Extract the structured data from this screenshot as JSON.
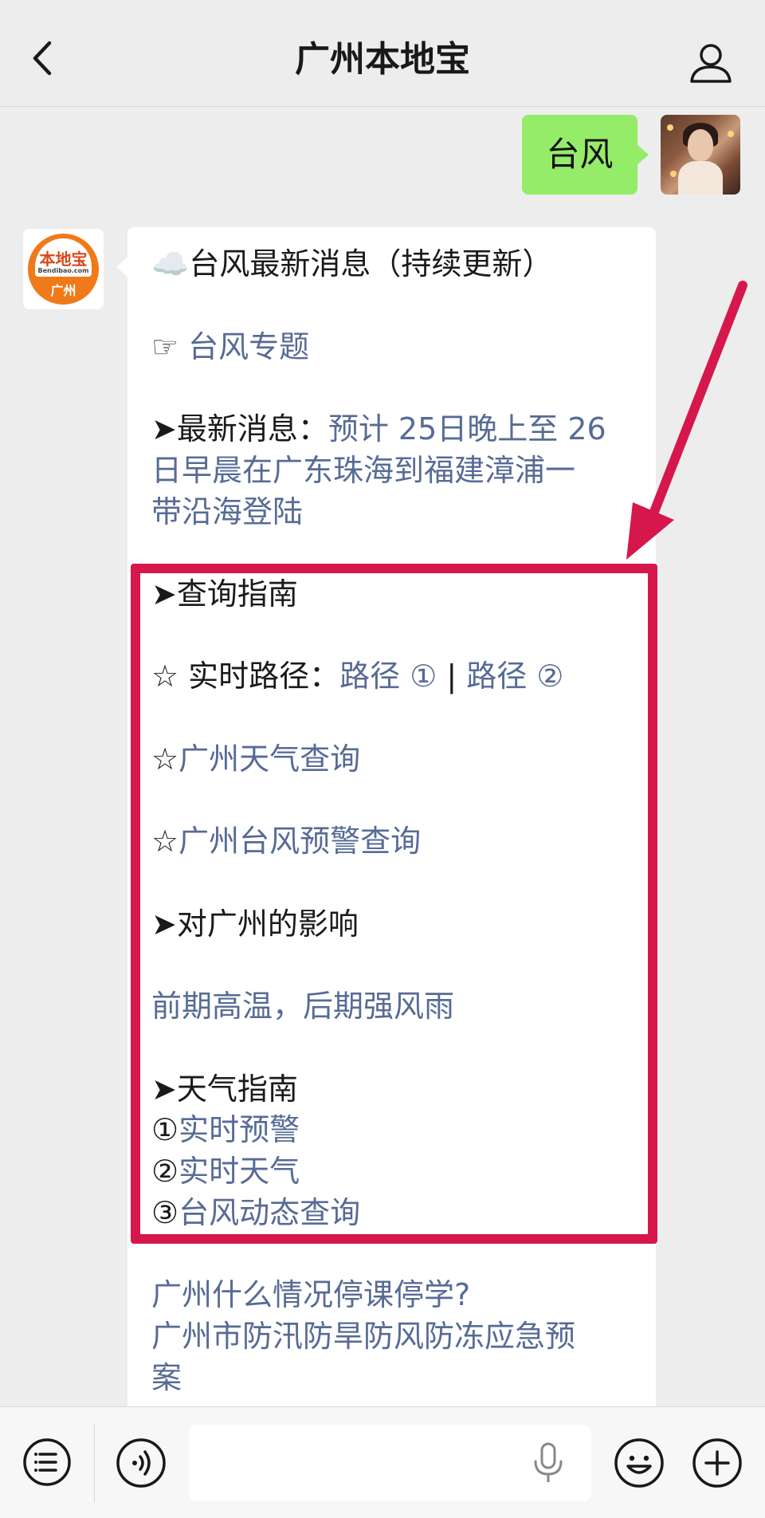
{
  "header": {
    "title": "广州本地宝"
  },
  "outgoing": {
    "text": "台风"
  },
  "sender": {
    "logo_text": "本地宝",
    "logo_sub": "Bendibao.com",
    "logo_city": "广州"
  },
  "message": {
    "title_icon": "☁️",
    "title": "台风最新消息（持续更新）",
    "topic_icon": "☞",
    "topic_link": "台风专题",
    "latest_prefix": "➤最新消息：",
    "latest_link_l1": "预计 25日晚上至 26",
    "latest_link_l2": "日早晨在广东珠海到福建漳浦一",
    "latest_link_l3": "带沿海登陆",
    "guide_heading": "➤查询指南",
    "route_prefix": "☆ 实时路径：",
    "route_link_1": "路径 ①",
    "route_sep": " | ",
    "route_link_2": "路径 ②",
    "weather_star": "☆",
    "weather_link": "广州天气查询",
    "typhoon_star": "☆",
    "typhoon_link": "广州台风预警查询",
    "impact_heading": "➤对广州的影响",
    "impact_link": "前期高温，后期强风雨",
    "weather_guide_heading": "➤天气指南",
    "wg_1_num": "①",
    "wg_1_link": "实时预警",
    "wg_2_num": "②",
    "wg_2_link": "实时天气",
    "wg_3_num": "③",
    "wg_3_link": "台风动态查询",
    "school_link": "广州什么情况停课停学?",
    "plan_link_l1": "广州市防汛防旱防风防冻应急预",
    "plan_link_l2": "案"
  },
  "colors": {
    "link": "#576b95",
    "outgoing_bubble": "#95ec69",
    "highlight": "#d6174c"
  }
}
